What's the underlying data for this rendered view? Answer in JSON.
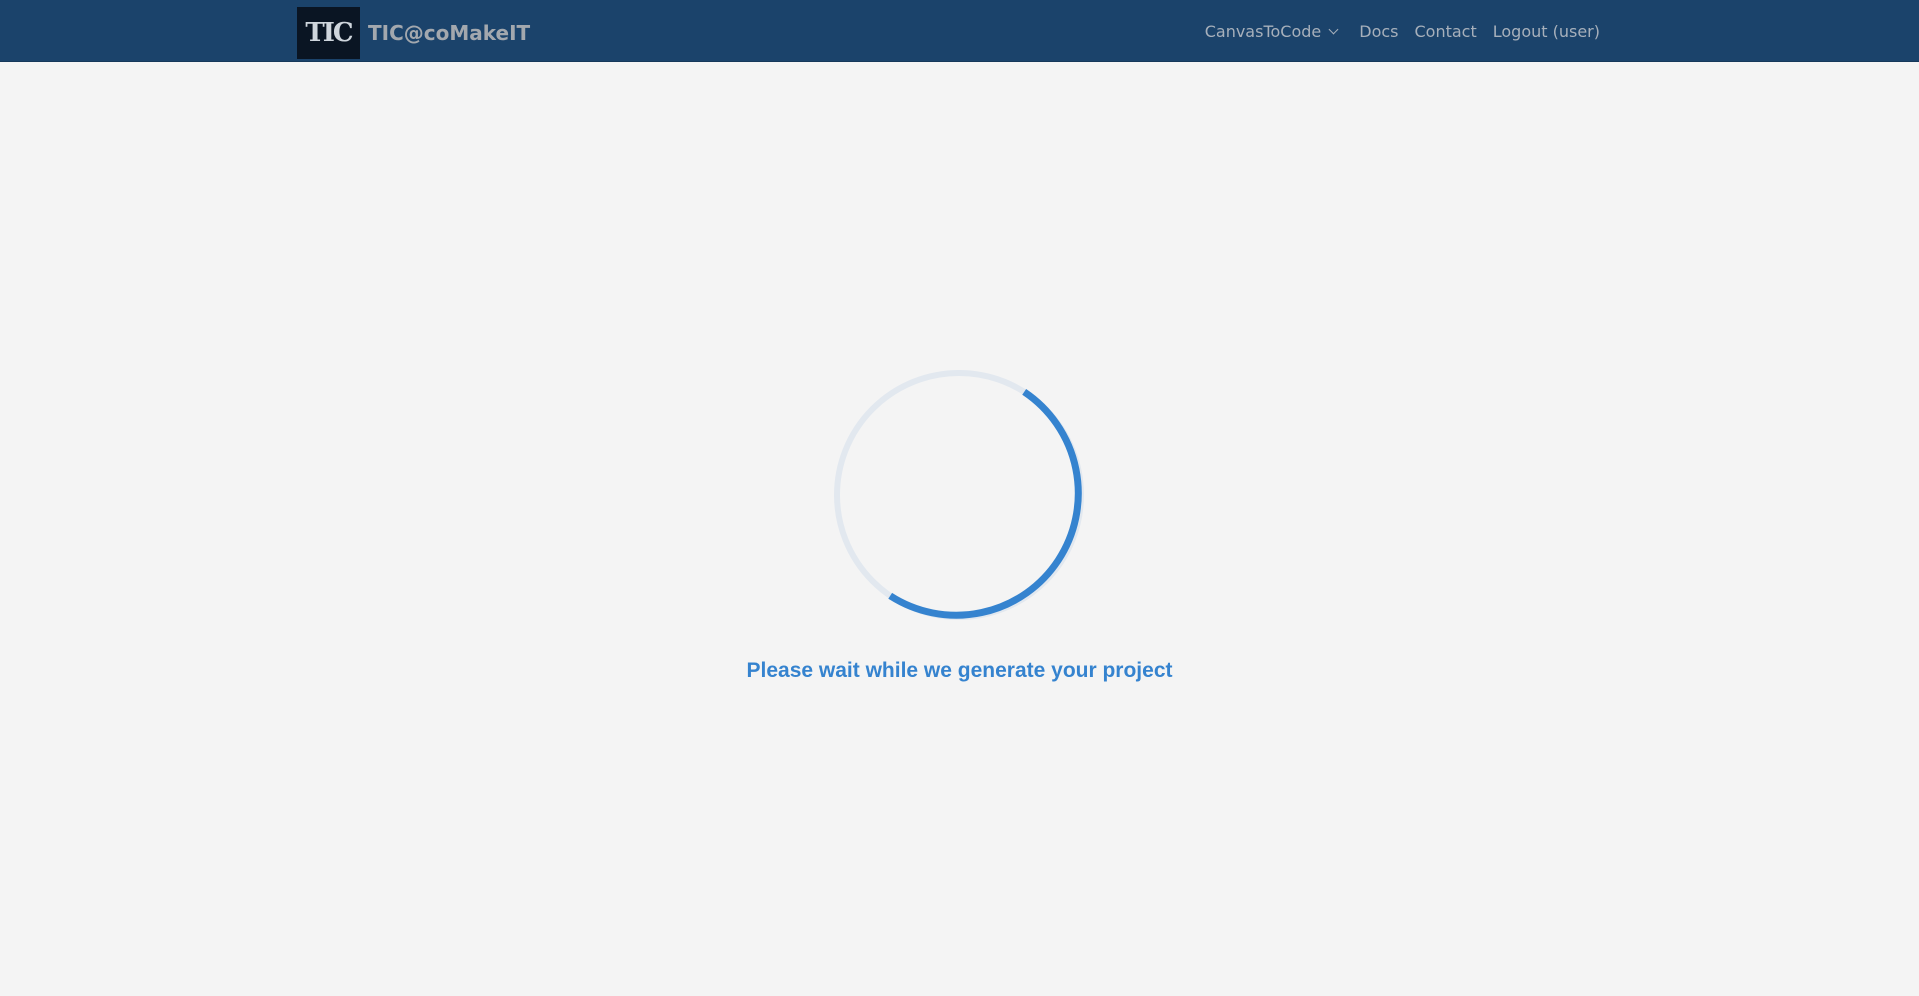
{
  "header": {
    "logo_text": "TIC",
    "brand_name": "TIC@coMakeIT",
    "nav": {
      "canvas_to_code": "CanvasToCode",
      "docs": "Docs",
      "contact": "Contact",
      "logout": "Logout (user)"
    }
  },
  "main": {
    "loading_message": "Please wait while we generate your project"
  },
  "colors": {
    "navbar_bg": "#1b436b",
    "page_bg": "#f4f4f4",
    "accent": "#3583cf",
    "spinner_track": "#e2e8ef"
  },
  "icons": {
    "dropdown": "chevron-down-icon",
    "spinner": "loading-spinner"
  }
}
